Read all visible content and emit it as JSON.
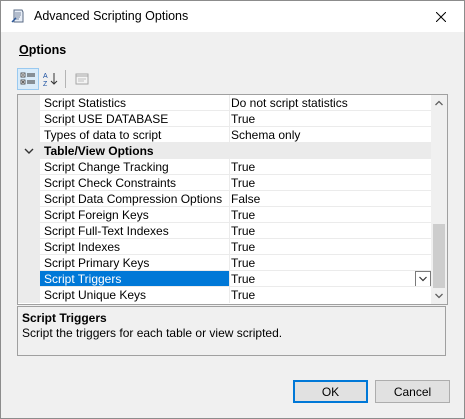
{
  "window": {
    "title": "Advanced Scripting Options",
    "icon": "scripting-wizard-icon"
  },
  "section": {
    "label_first": "O",
    "label_rest": "ptions"
  },
  "toolbar": {
    "categorized": "categorized-icon",
    "alphabetical": "sort-az-icon",
    "property_pages": "property-pages-icon"
  },
  "grid": {
    "rows": [
      {
        "type": "prop",
        "name": "Script Statistics",
        "value": "Do not script statistics"
      },
      {
        "type": "prop",
        "name": "Script USE DATABASE",
        "value": "True"
      },
      {
        "type": "prop",
        "name": "Types of data to script",
        "value": "Schema only"
      },
      {
        "type": "category",
        "name": "Table/View Options",
        "value": ""
      },
      {
        "type": "prop",
        "name": "Script Change Tracking",
        "value": "True"
      },
      {
        "type": "prop",
        "name": "Script Check Constraints",
        "value": "True"
      },
      {
        "type": "prop",
        "name": "Script Data Compression Options",
        "value": "False"
      },
      {
        "type": "prop",
        "name": "Script Foreign Keys",
        "value": "True"
      },
      {
        "type": "prop",
        "name": "Script Full-Text Indexes",
        "value": "True"
      },
      {
        "type": "prop",
        "name": "Script Indexes",
        "value": "True"
      },
      {
        "type": "prop",
        "name": "Script Primary Keys",
        "value": "True"
      },
      {
        "type": "prop",
        "name": "Script Triggers",
        "value": "True",
        "selected": true
      },
      {
        "type": "prop",
        "name": "Script Unique Keys",
        "value": "True"
      }
    ]
  },
  "description": {
    "title": "Script Triggers",
    "text": "Script the triggers for each table or view scripted."
  },
  "buttons": {
    "ok": "OK",
    "cancel": "Cancel"
  },
  "colors": {
    "selection": "#0078d7",
    "ok_border": "#0078d7"
  }
}
